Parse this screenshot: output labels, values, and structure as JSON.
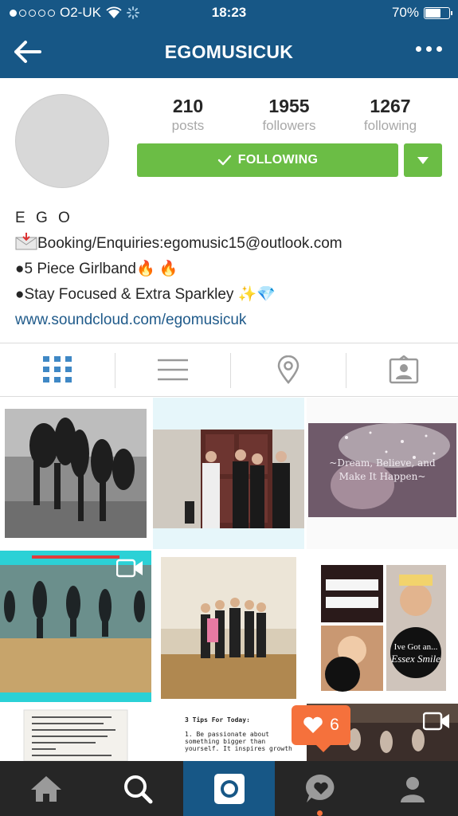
{
  "status_bar": {
    "carrier": "O2-UK",
    "time": "18:23",
    "battery": "70%",
    "battery_level": 0.7
  },
  "nav": {
    "title": "EGOMUSICUK",
    "back_icon": "back-arrow-icon",
    "more_icon": "more-dots-icon"
  },
  "profile": {
    "stats": [
      {
        "value": "210",
        "label": "posts"
      },
      {
        "value": "1955",
        "label": "followers"
      },
      {
        "value": "1267",
        "label": "following"
      }
    ],
    "follow_button": "FOLLOWING",
    "bio": {
      "name": "E G O",
      "line1": "Booking/Enquiries:egomusic15@outlook.com",
      "line2": "●5 Piece Girlband🔥 🔥",
      "line3": "●Stay Focused & Extra Sparkley ✨💎",
      "link": "www.soundcloud.com/egomusicuk"
    }
  },
  "tabs": [
    {
      "icon": "grid-icon",
      "active": true
    },
    {
      "icon": "list-icon",
      "active": false
    },
    {
      "icon": "location-pin-icon",
      "active": false
    },
    {
      "icon": "tagged-user-icon",
      "active": false
    }
  ],
  "grid_posts": [
    {
      "type": "photo",
      "theme": "bw-group"
    },
    {
      "type": "photo",
      "theme": "door-band"
    },
    {
      "type": "photo",
      "theme": "sparkle-quote",
      "caption": "~Dream, Believe, and\nMake It Happen~"
    },
    {
      "type": "video",
      "theme": "dance-studio"
    },
    {
      "type": "photo",
      "theme": "dance-group"
    },
    {
      "type": "photo",
      "theme": "essex-smile",
      "caption": "Ive Got an... Essex Smile"
    },
    {
      "type": "photo",
      "theme": "text-note"
    },
    {
      "type": "photo",
      "theme": "tips-text",
      "caption": "3 Tips For Today:",
      "text": "1. Be passionate about\nsomething bigger than\nyourself. It inspires growth"
    },
    {
      "type": "video",
      "theme": "dark-studio"
    }
  ],
  "notification": {
    "count": "6",
    "icon": "heart-icon"
  },
  "bottom_nav": [
    {
      "icon": "home-icon",
      "active": false
    },
    {
      "icon": "search-icon",
      "active": false
    },
    {
      "icon": "camera-icon",
      "active": true
    },
    {
      "icon": "activity-heart-icon",
      "active": false
    },
    {
      "icon": "profile-icon",
      "active": false
    }
  ],
  "colors": {
    "header": "#175786",
    "follow_green": "#6bbd45",
    "link_blue": "#1f5a8a",
    "notification_orange": "#f5713c",
    "bottom_bar": "#262626"
  }
}
